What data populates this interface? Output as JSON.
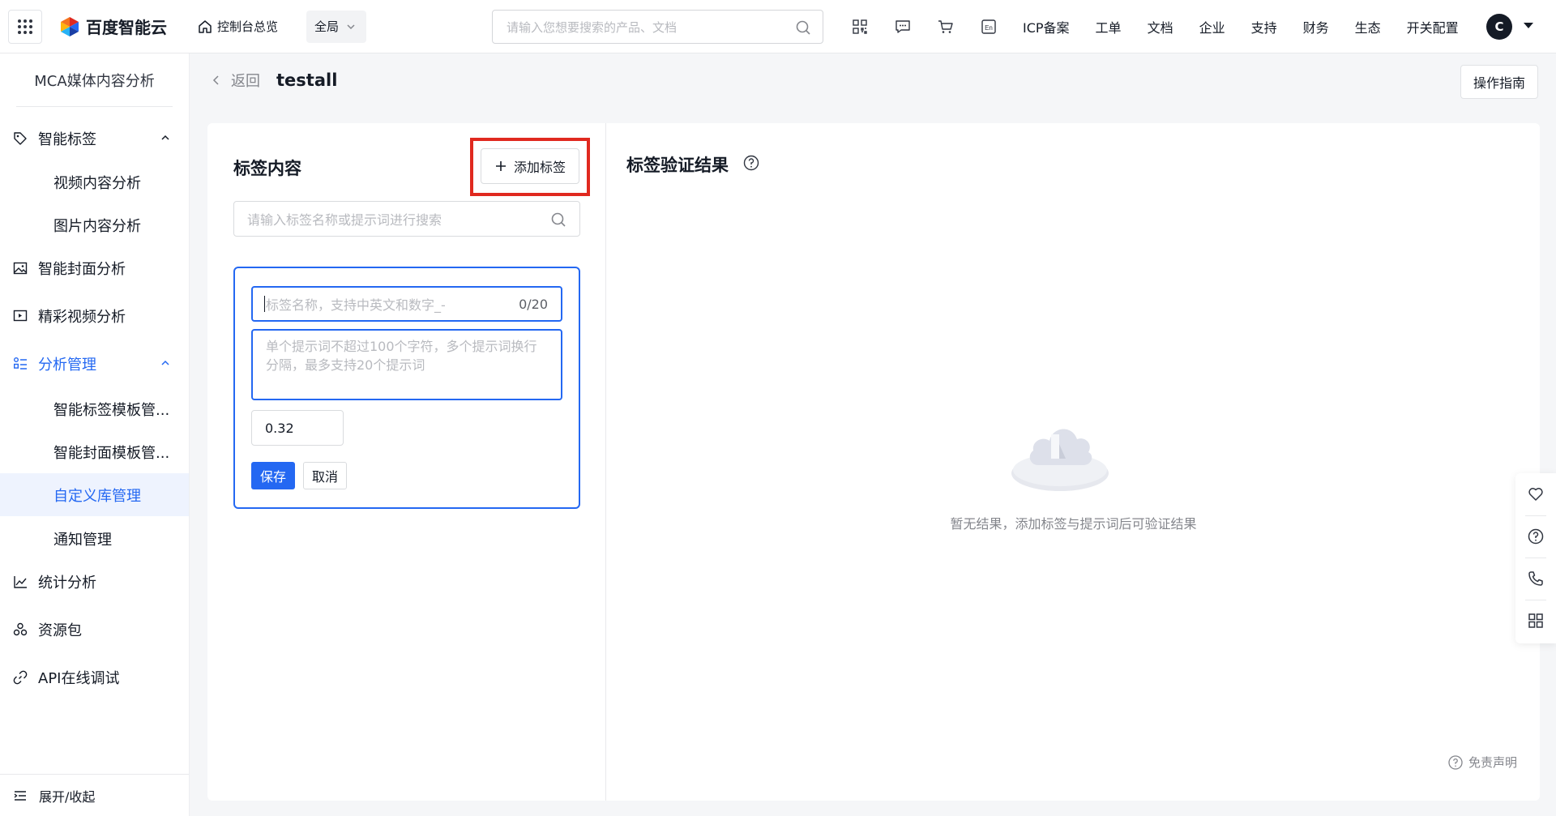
{
  "topbar": {
    "brand": "百度智能云",
    "home_label": "控制台总览",
    "region": "全局",
    "search_placeholder": "请输入您想要搜索的产品、文档",
    "nav": [
      "ICP备案",
      "工单",
      "文档",
      "企业",
      "支持",
      "财务",
      "生态",
      "开关配置"
    ],
    "avatar_letter": "C",
    "icons": [
      "qrcode-icon",
      "message-icon",
      "cart-icon",
      "language-en-icon"
    ]
  },
  "sidebar": {
    "title": "MCA媒体内容分析",
    "items": [
      {
        "label": "智能标签",
        "icon": "tag-icon"
      },
      {
        "label": "视频内容分析"
      },
      {
        "label": "图片内容分析"
      },
      {
        "label": "智能封面分析",
        "icon": "image-icon"
      },
      {
        "label": "精彩视频分析",
        "icon": "video-icon"
      },
      {
        "label": "分析管理",
        "icon": "manage-icon"
      },
      {
        "label": "智能标签模板管..."
      },
      {
        "label": "智能封面模板管..."
      },
      {
        "label": "自定义库管理"
      },
      {
        "label": "通知管理"
      },
      {
        "label": "统计分析",
        "icon": "chart-icon"
      },
      {
        "label": "资源包",
        "icon": "package-icon"
      },
      {
        "label": "API在线调试",
        "icon": "link-icon"
      }
    ],
    "footer": "展开/收起"
  },
  "header": {
    "back_label": "返回",
    "title": "testall",
    "guide_label": "操作指南"
  },
  "left_panel": {
    "title": "标签内容",
    "add_label": "添加标签",
    "search_placeholder": "请输入标签名称或提示词进行搜索",
    "form": {
      "name_placeholder": "标签名称，支持中英文和数字_-",
      "name_counter": "0/20",
      "prompt_placeholder": "单个提示词不超过100个字符，多个提示词换行分隔，最多支持20个提示词",
      "score_value": "0.32",
      "save_label": "保存",
      "cancel_label": "取消"
    }
  },
  "right_panel": {
    "title": "标签验证结果",
    "empty_text": "暂无结果，添加标签与提示词后可验证结果",
    "disclaimer": "免责声明"
  },
  "colors": {
    "primary": "#2468f2",
    "highlight": "#e0291f"
  }
}
